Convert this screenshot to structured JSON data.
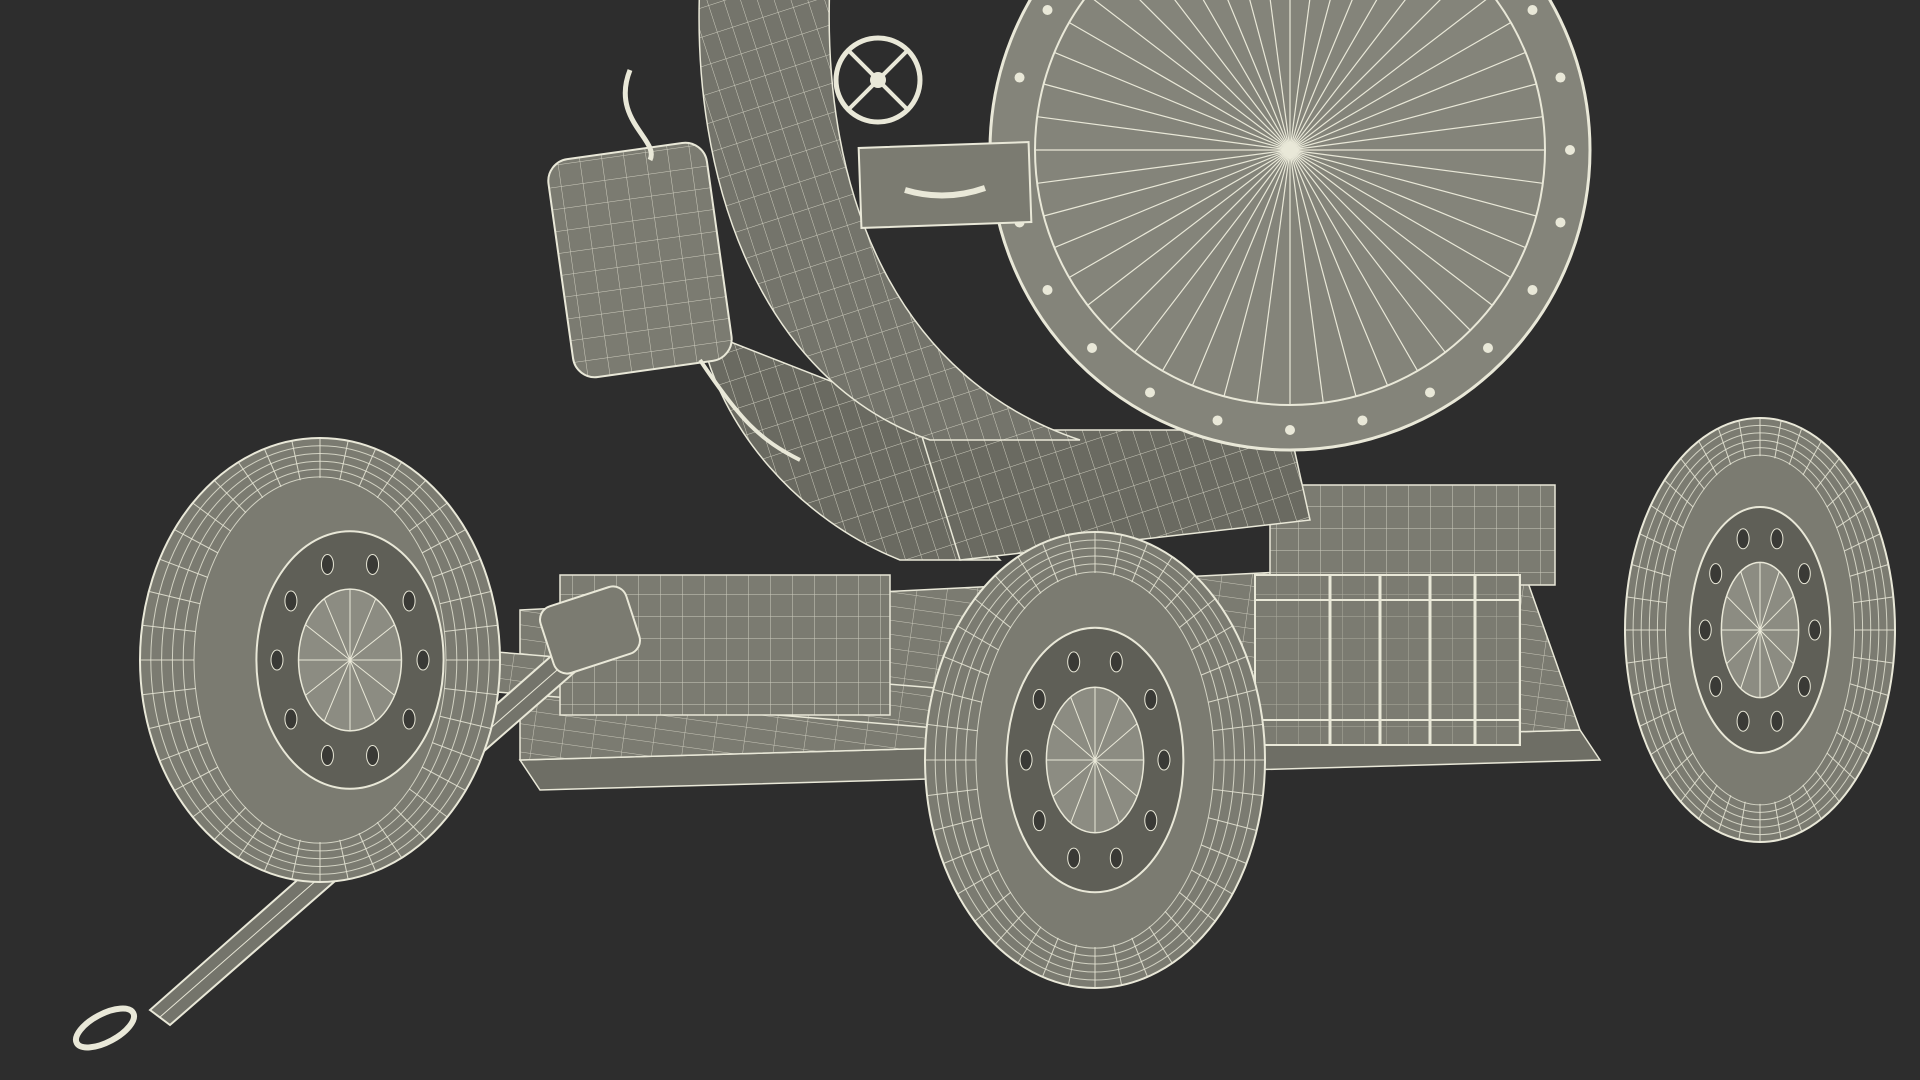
{
  "colors": {
    "background": "#2d2d2d",
    "mesh_fill": "#7b7b71",
    "mesh_fill_dark": "#5f5f57",
    "mesh_fill_light": "#8c8c82",
    "wire": "#e9e8d8"
  },
  "scene": {
    "subject": "searchlight-trailer-wireframe"
  }
}
